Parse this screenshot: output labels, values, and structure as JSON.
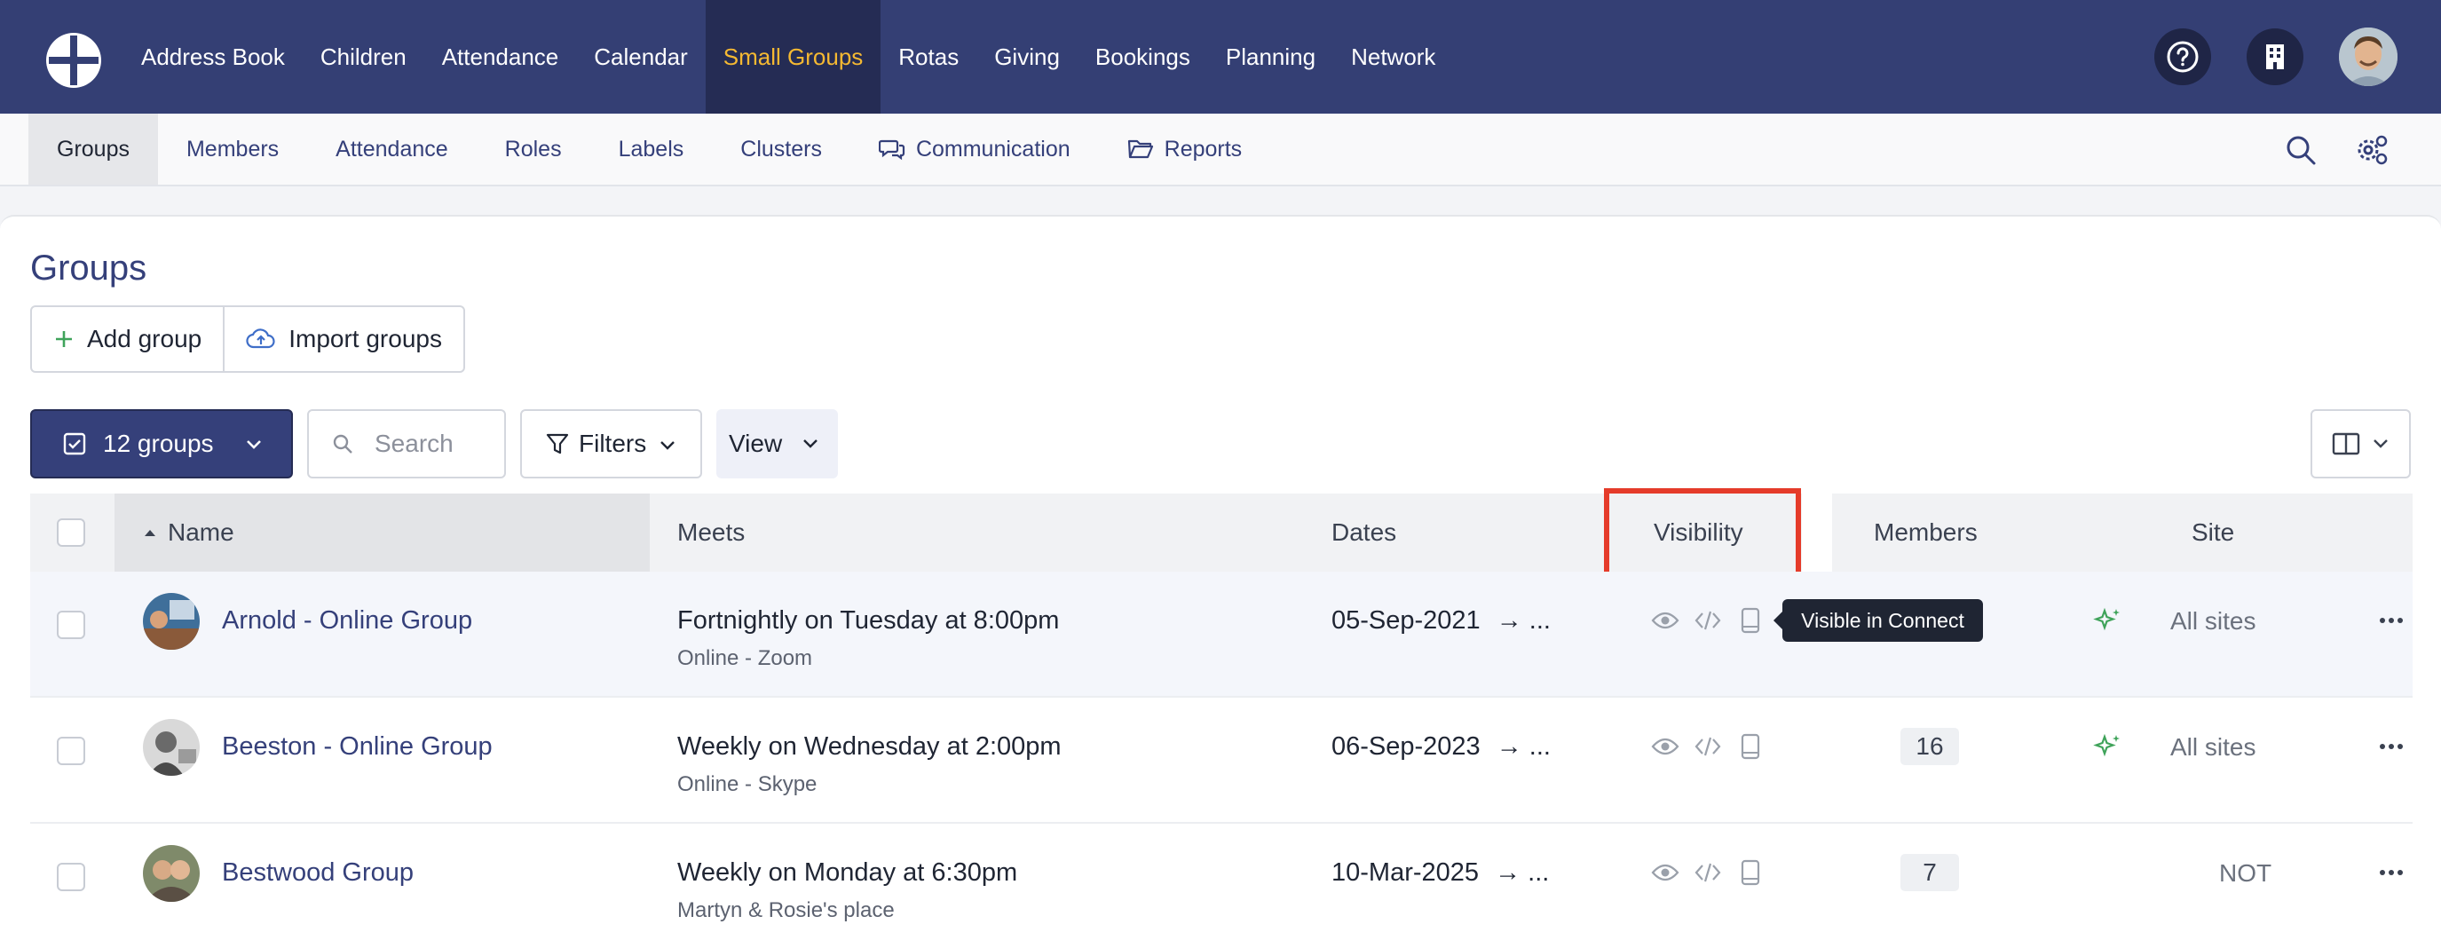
{
  "topnav": {
    "items": [
      {
        "label": "Address Book"
      },
      {
        "label": "Children"
      },
      {
        "label": "Attendance"
      },
      {
        "label": "Calendar"
      },
      {
        "label": "Small Groups",
        "active": true
      },
      {
        "label": "Rotas"
      },
      {
        "label": "Giving"
      },
      {
        "label": "Bookings"
      },
      {
        "label": "Planning"
      },
      {
        "label": "Network"
      }
    ],
    "icons": [
      "help-icon",
      "building-icon",
      "user-avatar"
    ],
    "active_color": "#f5b932",
    "background": "#343f74"
  },
  "subnav": {
    "items": [
      {
        "label": "Groups",
        "active": true
      },
      {
        "label": "Members"
      },
      {
        "label": "Attendance"
      },
      {
        "label": "Roles"
      },
      {
        "label": "Labels"
      },
      {
        "label": "Clusters"
      },
      {
        "label": "Communication",
        "icon": "chat-icon"
      },
      {
        "label": "Reports",
        "icon": "folder-icon"
      }
    ],
    "right_icons": [
      "search-icon",
      "settings-icon"
    ]
  },
  "page": {
    "title": "Groups",
    "add_group": "Add group",
    "import_groups": "Import groups"
  },
  "toolbar": {
    "selection_label": "12 groups",
    "search_placeholder": "Search",
    "filters_label": "Filters",
    "view_label": "View"
  },
  "table": {
    "headers": {
      "name": "Name",
      "meets": "Meets",
      "dates": "Dates",
      "visibility": "Visibility",
      "members": "Members",
      "site": "Site"
    },
    "sort": {
      "column": "Name",
      "direction": "ascending"
    },
    "rows": [
      {
        "name": "Arnold - Online Group",
        "meets": "Fortnightly on Tuesday at 8:00pm",
        "location": "Online - Zoom",
        "dates": "05-Sep-2021",
        "dates_suffix": "→ ...",
        "members": "",
        "site": "All sites",
        "hovered": true
      },
      {
        "name": "Beeston - Online Group",
        "meets": "Weekly on Wednesday at 2:00pm",
        "location": "Online - Skype",
        "dates": "06-Sep-2023",
        "dates_suffix": "→ ...",
        "members": "16",
        "site": "All sites"
      },
      {
        "name": "Bestwood Group",
        "meets": "Weekly on Monday at 6:30pm",
        "location": "Martyn & Rosie's place",
        "dates": "10-Mar-2025",
        "dates_suffix": "→ ...",
        "members": "7",
        "site": "NOT"
      }
    ]
  },
  "tooltip": {
    "text": "Visible in Connect"
  },
  "colors": {
    "brand": "#343f74",
    "highlight": "#e53b2a",
    "sparkle": "#3fa35a"
  }
}
